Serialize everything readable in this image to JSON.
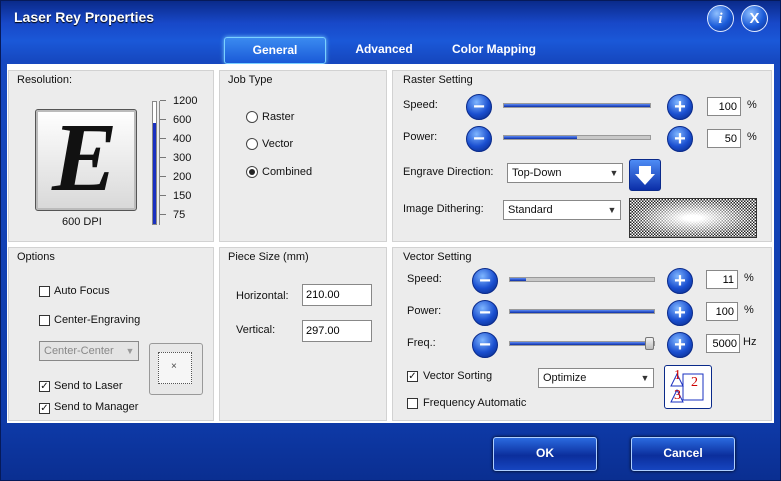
{
  "window": {
    "title": "Laser Rey Properties",
    "info_icon": "i",
    "close_icon": "X"
  },
  "tabs": [
    {
      "label": "General",
      "active": true
    },
    {
      "label": "Advanced",
      "active": false
    },
    {
      "label": "Color Mapping",
      "active": false
    }
  ],
  "resolution": {
    "title": "Resolution:",
    "preview_letter": "E",
    "dpi_label": "600 DPI",
    "ticks": [
      "1200",
      "600",
      "400",
      "300",
      "200",
      "150",
      "75"
    ],
    "selected_fraction": 0.83
  },
  "job_type": {
    "title": "Job Type",
    "options": [
      {
        "label": "Raster",
        "selected": false
      },
      {
        "label": "Vector",
        "selected": false
      },
      {
        "label": "Combined",
        "selected": true
      }
    ]
  },
  "raster": {
    "title": "Raster Setting",
    "speed_label": "Speed:",
    "speed_value": "100",
    "speed_unit": "%",
    "speed_fraction": 1.0,
    "power_label": "Power:",
    "power_value": "50",
    "power_unit": "%",
    "power_fraction": 0.5,
    "direction_label": "Engrave Direction:",
    "direction_value": "Top-Down",
    "dithering_label": "Image Dithering:",
    "dithering_value": "Standard"
  },
  "options": {
    "title": "Options",
    "auto_focus": {
      "label": "Auto Focus",
      "checked": false
    },
    "center_engraving": {
      "label": "Center-Engraving",
      "checked": false
    },
    "center_select": "Center-Center",
    "send_to_laser": {
      "label": "Send to Laser",
      "checked": true
    },
    "send_to_manager": {
      "label": "Send to Manager",
      "checked": true
    }
  },
  "piece_size": {
    "title": "Piece Size (mm)",
    "horizontal_label": "Horizontal:",
    "horizontal_value": "210.00",
    "vertical_label": "Vertical:",
    "vertical_value": "297.00"
  },
  "vector": {
    "title": "Vector Setting",
    "speed_label": "Speed:",
    "speed_value": "11",
    "speed_unit": "%",
    "speed_fraction": 0.11,
    "power_label": "Power:",
    "power_value": "100",
    "power_unit": "%",
    "power_fraction": 1.0,
    "freq_label": "Freq.:",
    "freq_value": "5000",
    "freq_unit": "Hz",
    "freq_fraction": 0.98,
    "sorting": {
      "label": "Vector Sorting",
      "checked": true
    },
    "sorting_select": "Optimize",
    "freq_auto": {
      "label": "Frequency Automatic",
      "checked": false
    },
    "order_digits": [
      "1",
      "2",
      "3"
    ]
  },
  "buttons": {
    "ok": "OK",
    "cancel": "Cancel"
  },
  "colors": {
    "accent": "#1a4fd0",
    "frame": "#0e3aa8",
    "panel": "#ececec"
  }
}
